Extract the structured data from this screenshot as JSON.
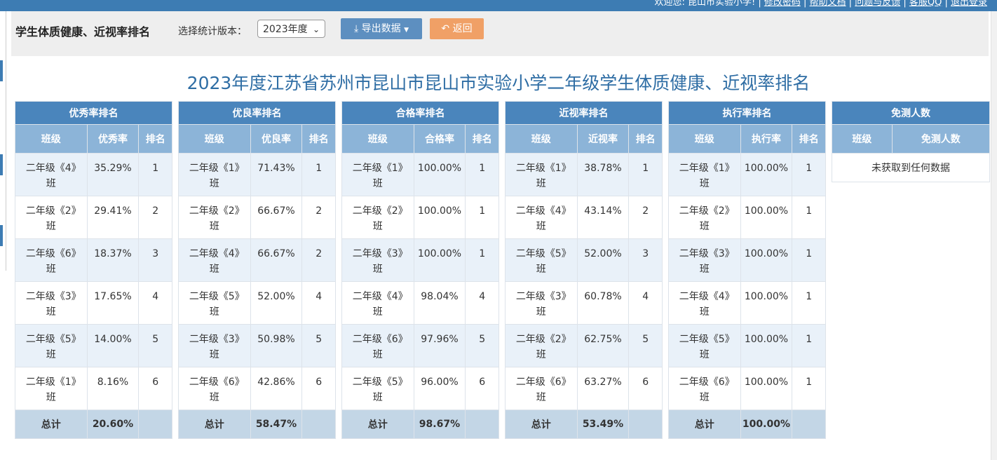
{
  "topbar": {
    "welcome": "欢迎您: 昆山市实验小学!",
    "links": [
      "修改密码",
      "帮助文档",
      "问题与反馈",
      "客服QQ",
      "退出登录"
    ]
  },
  "toolbar": {
    "page_title": "学生体质健康、近视率排名",
    "version_label": "选择统计版本：",
    "version_value": "2023年度",
    "export_label": "导出数据",
    "back_label": "返回"
  },
  "report_title": "2023年度江苏省苏州市昆山市昆山市实验小学二年级学生体质健康、近视率排名",
  "tables": [
    {
      "caption": "优秀率排名",
      "headers": [
        "班级",
        "优秀率",
        "排名"
      ],
      "rows": [
        [
          "二年级《4》班",
          "35.29%",
          "1"
        ],
        [
          "二年级《2》班",
          "29.41%",
          "2"
        ],
        [
          "二年级《6》班",
          "18.37%",
          "3"
        ],
        [
          "二年级《3》班",
          "17.65%",
          "4"
        ],
        [
          "二年级《5》班",
          "14.00%",
          "5"
        ],
        [
          "二年级《1》班",
          "8.16%",
          "6"
        ]
      ],
      "total": [
        "总计",
        "20.60%",
        ""
      ]
    },
    {
      "caption": "优良率排名",
      "headers": [
        "班级",
        "优良率",
        "排名"
      ],
      "rows": [
        [
          "二年级《1》班",
          "71.43%",
          "1"
        ],
        [
          "二年级《2》班",
          "66.67%",
          "2"
        ],
        [
          "二年级《4》班",
          "66.67%",
          "2"
        ],
        [
          "二年级《5》班",
          "52.00%",
          "4"
        ],
        [
          "二年级《3》班",
          "50.98%",
          "5"
        ],
        [
          "二年级《6》班",
          "42.86%",
          "6"
        ]
      ],
      "total": [
        "总计",
        "58.47%",
        ""
      ]
    },
    {
      "caption": "合格率排名",
      "headers": [
        "班级",
        "合格率",
        "排名"
      ],
      "rows": [
        [
          "二年级《1》班",
          "100.00%",
          "1"
        ],
        [
          "二年级《2》班",
          "100.00%",
          "1"
        ],
        [
          "二年级《3》班",
          "100.00%",
          "1"
        ],
        [
          "二年级《4》班",
          "98.04%",
          "4"
        ],
        [
          "二年级《6》班",
          "97.96%",
          "5"
        ],
        [
          "二年级《5》班",
          "96.00%",
          "6"
        ]
      ],
      "total": [
        "总计",
        "98.67%",
        ""
      ]
    },
    {
      "caption": "近视率排名",
      "headers": [
        "班级",
        "近视率",
        "排名"
      ],
      "rows": [
        [
          "二年级《1》班",
          "38.78%",
          "1"
        ],
        [
          "二年级《4》班",
          "43.14%",
          "2"
        ],
        [
          "二年级《5》班",
          "52.00%",
          "3"
        ],
        [
          "二年级《3》班",
          "60.78%",
          "4"
        ],
        [
          "二年级《2》班",
          "62.75%",
          "5"
        ],
        [
          "二年级《6》班",
          "63.27%",
          "6"
        ]
      ],
      "total": [
        "总计",
        "53.49%",
        ""
      ]
    },
    {
      "caption": "执行率排名",
      "headers": [
        "班级",
        "执行率",
        "排名"
      ],
      "rows": [
        [
          "二年级《1》班",
          "100.00%",
          "1"
        ],
        [
          "二年级《2》班",
          "100.00%",
          "1"
        ],
        [
          "二年级《3》班",
          "100.00%",
          "1"
        ],
        [
          "二年级《4》班",
          "100.00%",
          "1"
        ],
        [
          "二年级《5》班",
          "100.00%",
          "1"
        ],
        [
          "二年级《6》班",
          "100.00%",
          "1"
        ]
      ],
      "total": [
        "总计",
        "100.00%",
        ""
      ]
    }
  ],
  "exempt_table": {
    "caption": "免测人数",
    "headers": [
      "班级",
      "免测人数"
    ],
    "empty_text": "未获取到任何数据"
  }
}
